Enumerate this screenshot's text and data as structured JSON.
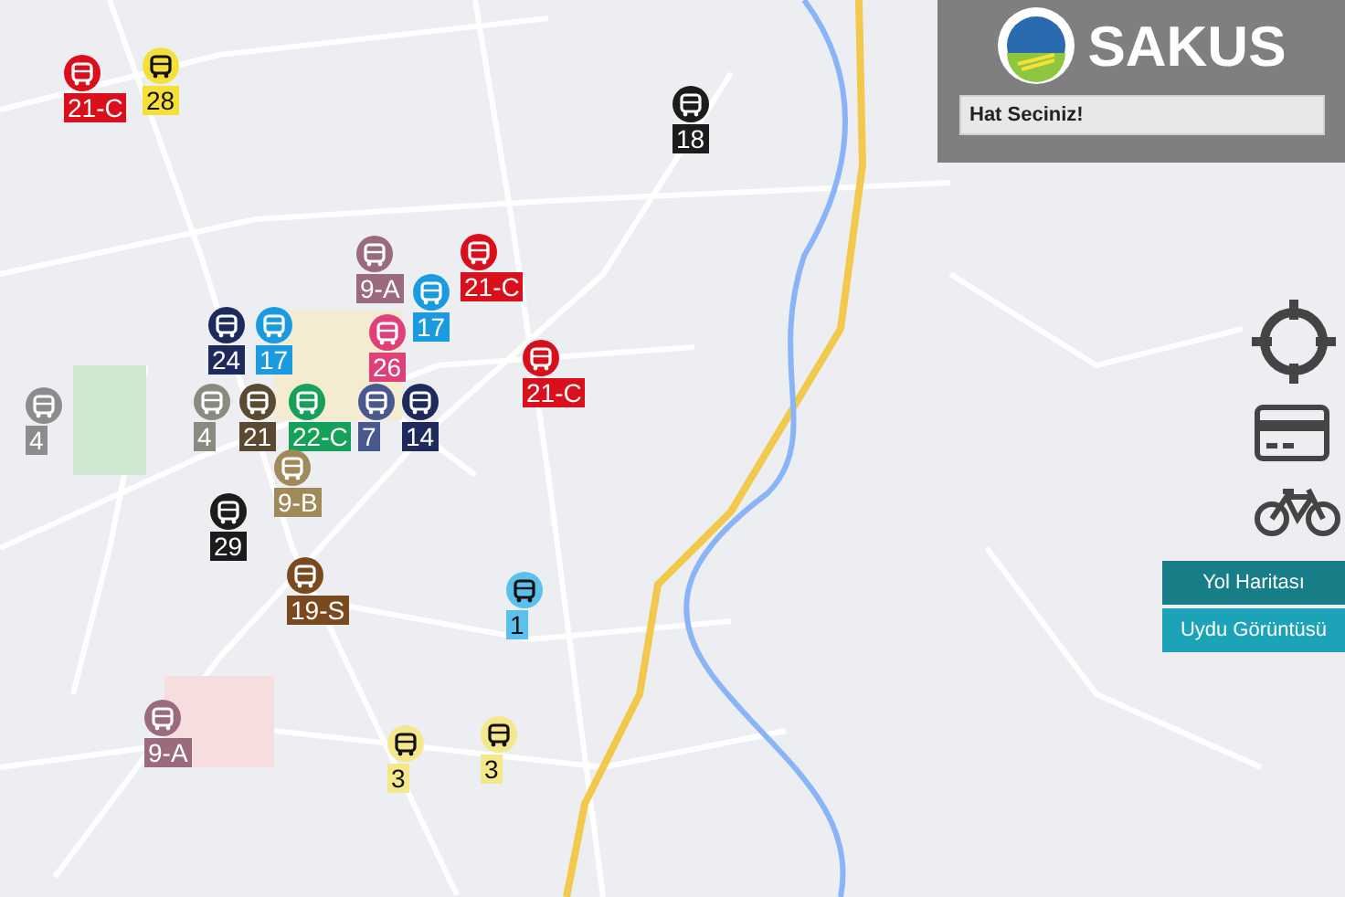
{
  "panel": {
    "title": "SAKUS",
    "route_select": {
      "placeholder": "Hat Seciniz!"
    }
  },
  "map_types": [
    {
      "label": "Yol Haritası",
      "selected": true
    },
    {
      "label": "Uydu Görüntüsü",
      "selected": false
    }
  ],
  "buses": [
    {
      "route": "21-C",
      "color": "#d9101c"
    },
    {
      "route": "28",
      "color": "#f5e03a"
    },
    {
      "route": "18",
      "color": "#1c1c1c"
    },
    {
      "route": "9-A",
      "color": "#9b6a7c"
    },
    {
      "route": "21-C",
      "color": "#d9101c"
    },
    {
      "route": "17",
      "color": "#1a9be0"
    },
    {
      "route": "24",
      "color": "#1f2a5c"
    },
    {
      "route": "17",
      "color": "#1a9be0"
    },
    {
      "route": "26",
      "color": "#e0407a"
    },
    {
      "route": "21-C",
      "color": "#d9101c"
    },
    {
      "route": "4",
      "color": "#8c8c8c"
    },
    {
      "route": "4",
      "color": "#8a8a80"
    },
    {
      "route": "21",
      "color": "#5b4a32"
    },
    {
      "route": "22-C",
      "color": "#17a05a"
    },
    {
      "route": "7",
      "color": "#4a5890"
    },
    {
      "route": "14",
      "color": "#1f2a5c"
    },
    {
      "route": "9-B",
      "color": "#a08a5a"
    },
    {
      "route": "29",
      "color": "#1c1c1c"
    },
    {
      "route": "19-S",
      "color": "#7a4a1e"
    },
    {
      "route": "1",
      "color": "#5bc0eb"
    },
    {
      "route": "9-A",
      "color": "#9b6a7c"
    },
    {
      "route": "3",
      "color": "#f5e88a"
    },
    {
      "route": "3",
      "color": "#f5e88a"
    }
  ]
}
